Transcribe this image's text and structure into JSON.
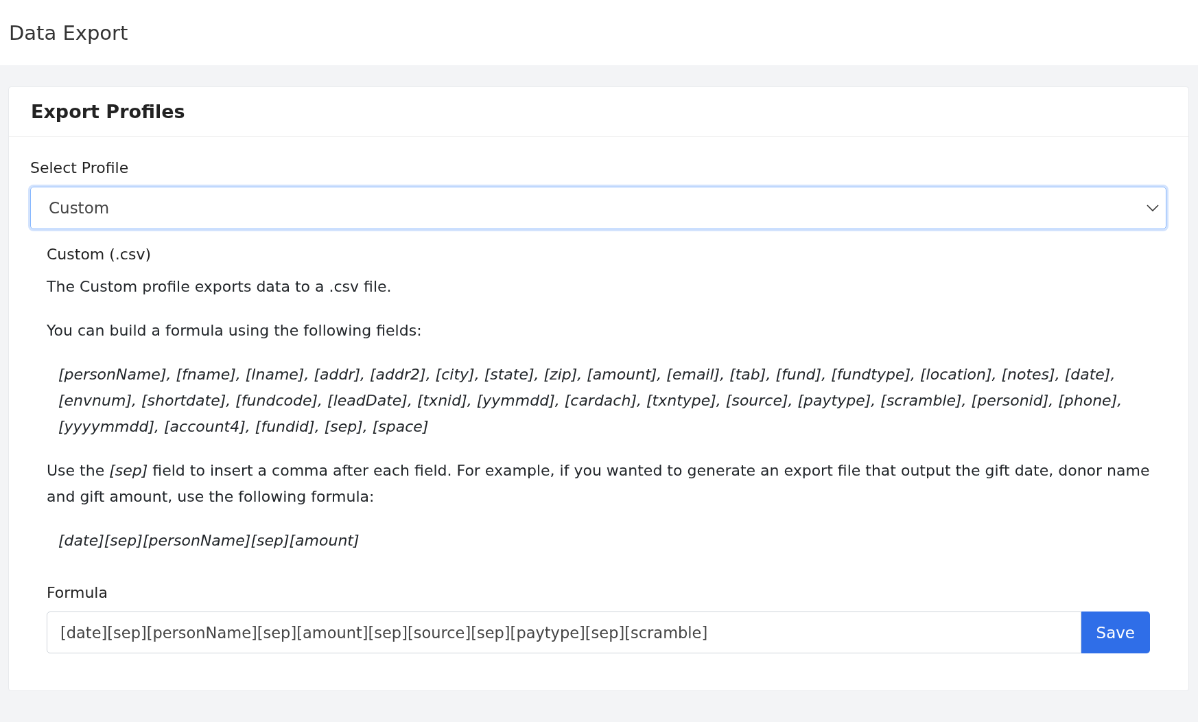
{
  "page": {
    "title": "Data Export"
  },
  "card": {
    "title": "Export Profiles",
    "select": {
      "label": "Select Profile",
      "value": "Custom",
      "focused": true
    },
    "profile": {
      "heading": "Custom (.csv)",
      "paragraphs": [
        {
          "kind": "text",
          "text": "The Custom profile exports data to a .csv file."
        },
        {
          "kind": "text",
          "text": "You can build a formula using the following fields:"
        },
        {
          "kind": "code",
          "text": "[personName], [fname], [lname], [addr], [addr2], [city], [state], [zip], [amount], [email], [tab], [fund], [fundtype], [location], [notes], [date], [envnum], [shortdate], [fundcode], [leadDate], [txnid], [yymmdd], [cardach], [txntype], [source], [paytype], [scramble], [personid], [phone], [yyyymmdd], [account4], [fundid], [sep], [space]"
        },
        {
          "kind": "text",
          "text": "Use the *[sep]* field to insert a comma after each field. For example, if you wanted to generate an export file that output the gift date, donor name and gift amount, use the following formula:"
        },
        {
          "kind": "code",
          "text": "[date][sep][personName][sep][amount]"
        }
      ]
    },
    "formula": {
      "label": "Formula",
      "value": "[date][sep][personName][sep][amount][sep][source][sep][paytype][sep][scramble]",
      "button": "Save"
    }
  }
}
